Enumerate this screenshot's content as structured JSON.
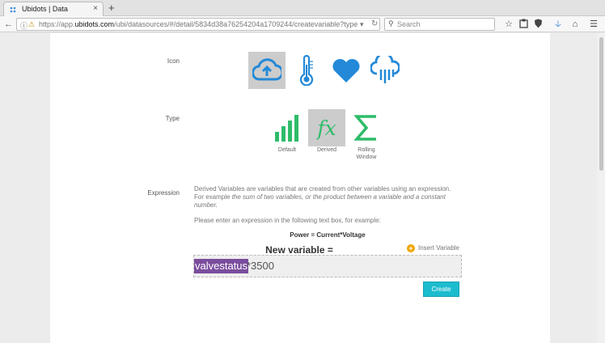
{
  "browser": {
    "tab_title": "Ubidots | Data",
    "tab_close": "×",
    "new_tab": "+",
    "url_prefix": "https://app.",
    "url_domain": "ubidots.com",
    "url_path": "/ubi/datasources/#/detail/5834d38a76254204a1709244/createvariable?type",
    "search_placeholder": "Search",
    "toolbar_icons": [
      "star-icon",
      "clipboard-icon",
      "shield-icon",
      "download-icon",
      "home-icon",
      "menu-icon"
    ]
  },
  "form": {
    "icon_label": "Icon",
    "type_label": "Type",
    "expression_label": "Expression",
    "icons": [
      "cloud-upload-icon",
      "thermometer-icon",
      "heart-icon",
      "cloud-rain-icon"
    ],
    "selected_icon": "cloud-upload-icon",
    "types": [
      {
        "label": "Default",
        "icon": "bars-icon"
      },
      {
        "label": "Derived",
        "icon": "function-icon"
      },
      {
        "label": "Rolling Window",
        "icon": "sigma-icon"
      }
    ],
    "selected_type": "Derived",
    "description_1": "Derived Variables are variables that are created from other variables using an expression.",
    "description_2a": "For example ",
    "description_2b": "the sum of two variables, or the product between a variable and a constant",
    "description_3": "number.",
    "description_4": "Please enter an expression in the following text box, for example:",
    "example_formula": "Power = Current*Voltage",
    "new_variable_label": "New variable =",
    "insert_variable": "Insert Variable",
    "expression_variable": "valvestatus",
    "expression_rest": "*3500",
    "create_button": "Create"
  },
  "colors": {
    "green": "#2ebc6a",
    "blue": "#2389d8",
    "selected_bg": "#cccccc",
    "variable_chip": "#7a4d9d",
    "create_button": "#1cbccf"
  }
}
